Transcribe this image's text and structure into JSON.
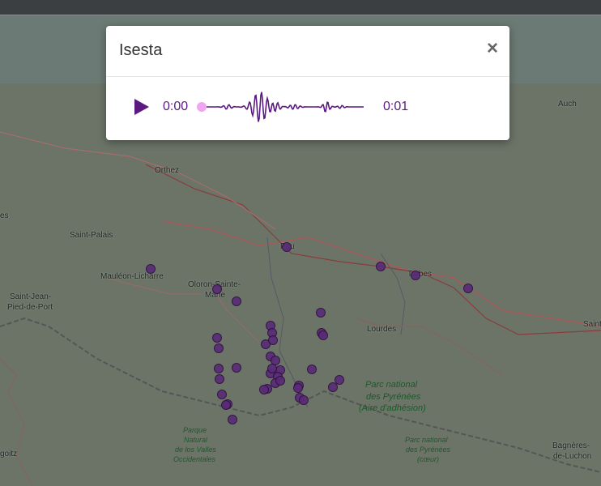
{
  "modal": {
    "title": "Isesta",
    "close_label": "×",
    "player": {
      "current_time": "0:00",
      "total_time": "0:01",
      "progress": 0,
      "accent_color": "#5b1a80",
      "handle_color": "#f0a6f0"
    }
  },
  "map": {
    "labels": {
      "auch": "Auch",
      "orthez": "Orthez",
      "saint_palais": "Saint-Palais",
      "mauleon": "Mauléon-Licharre",
      "oloron_1": "Oloron-Sainte-",
      "oloron_2": "Marie",
      "saint_jean_1": "Saint-Jean-",
      "saint_jean_2": "Pied-de-Port",
      "pau": "Pau",
      "tarbes": "Tarbes",
      "lourdes": "Lourdes",
      "saint_right": "Saint",
      "parc_1": "Parc national",
      "parc_2": "des Pyrénées",
      "parc_3": "(Aire d'adhésion)",
      "pnvo_1": "Parque",
      "pnvo_2": "Natural",
      "pnvo_3": "de los Valles",
      "pnvo_4": "Occidentales",
      "pnc_1": "Parc national",
      "pnc_2": "des Pyrénées",
      "pnc_3": "(cœur)",
      "bagneres_1": "Bagnères-",
      "bagneres_2": "de-Luchon",
      "goitz": "goitz",
      "es": "es"
    },
    "marker_color": "#5a2a78"
  }
}
